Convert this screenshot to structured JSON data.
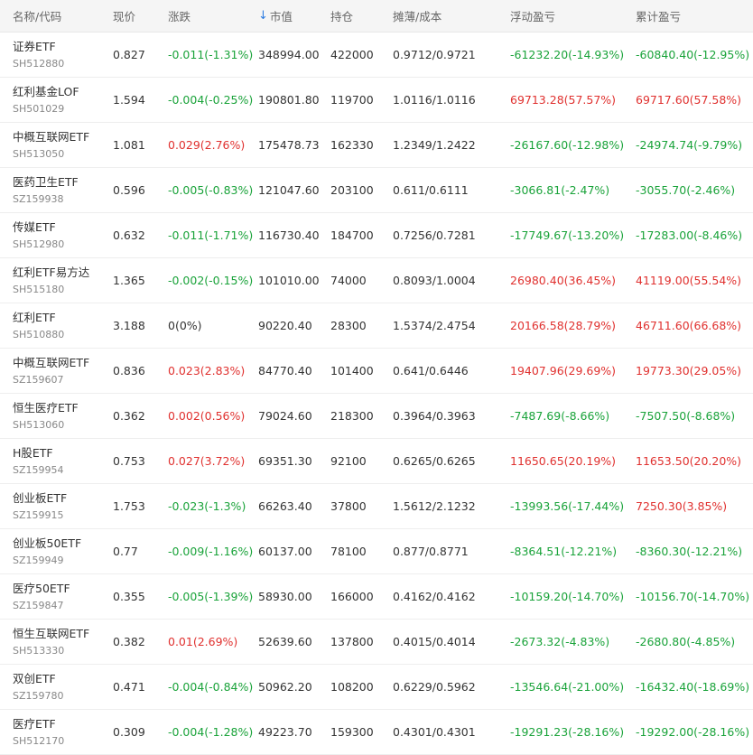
{
  "colors": {
    "up": "#e0312f",
    "down": "#1aa33a",
    "flat": "#333333",
    "sort_arrow": "#2f7de1"
  },
  "header": {
    "name_code": "名称/代码",
    "price": "现价",
    "change": "涨跌",
    "sort_icon": "arrow-down-icon",
    "market_value": "市值",
    "position": "持仓",
    "cost": "摊薄/成本",
    "floating_pl": "浮动盈亏",
    "cumulative_pl": "累计盈亏"
  },
  "rows": [
    {
      "name": "证券ETF",
      "code": "SH512880",
      "price": "0.827",
      "change": "-0.011(-1.31%)",
      "change_dir": "neg",
      "market_value": "348994.00",
      "position": "422000",
      "cost": "0.9712/0.9721",
      "floating_pl": "-61232.20(-14.93%)",
      "floating_dir": "neg",
      "cumulative_pl": "-60840.40(-12.95%)",
      "cumulative_dir": "neg"
    },
    {
      "name": "红利基金LOF",
      "code": "SH501029",
      "price": "1.594",
      "change": "-0.004(-0.25%)",
      "change_dir": "neg",
      "market_value": "190801.80",
      "position": "119700",
      "cost": "1.0116/1.0116",
      "floating_pl": "69713.28(57.57%)",
      "floating_dir": "pos",
      "cumulative_pl": "69717.60(57.58%)",
      "cumulative_dir": "pos"
    },
    {
      "name": "中概互联网ETF",
      "code": "SH513050",
      "price": "1.081",
      "change": "0.029(2.76%)",
      "change_dir": "pos",
      "market_value": "175478.73",
      "position": "162330",
      "cost": "1.2349/1.2422",
      "floating_pl": "-26167.60(-12.98%)",
      "floating_dir": "neg",
      "cumulative_pl": "-24974.74(-9.79%)",
      "cumulative_dir": "neg"
    },
    {
      "name": "医药卫生ETF",
      "code": "SZ159938",
      "price": "0.596",
      "change": "-0.005(-0.83%)",
      "change_dir": "neg",
      "market_value": "121047.60",
      "position": "203100",
      "cost": "0.611/0.6111",
      "floating_pl": "-3066.81(-2.47%)",
      "floating_dir": "neg",
      "cumulative_pl": "-3055.70(-2.46%)",
      "cumulative_dir": "neg"
    },
    {
      "name": "传媒ETF",
      "code": "SH512980",
      "price": "0.632",
      "change": "-0.011(-1.71%)",
      "change_dir": "neg",
      "market_value": "116730.40",
      "position": "184700",
      "cost": "0.7256/0.7281",
      "floating_pl": "-17749.67(-13.20%)",
      "floating_dir": "neg",
      "cumulative_pl": "-17283.00(-8.46%)",
      "cumulative_dir": "neg"
    },
    {
      "name": "红利ETF易方达",
      "code": "SH515180",
      "price": "1.365",
      "change": "-0.002(-0.15%)",
      "change_dir": "neg",
      "market_value": "101010.00",
      "position": "74000",
      "cost": "0.8093/1.0004",
      "floating_pl": "26980.40(36.45%)",
      "floating_dir": "pos",
      "cumulative_pl": "41119.00(55.54%)",
      "cumulative_dir": "pos"
    },
    {
      "name": "红利ETF",
      "code": "SH510880",
      "price": "3.188",
      "change": "0(0%)",
      "change_dir": "neu",
      "market_value": "90220.40",
      "position": "28300",
      "cost": "1.5374/2.4754",
      "floating_pl": "20166.58(28.79%)",
      "floating_dir": "pos",
      "cumulative_pl": "46711.60(66.68%)",
      "cumulative_dir": "pos"
    },
    {
      "name": "中概互联网ETF",
      "code": "SZ159607",
      "price": "0.836",
      "change": "0.023(2.83%)",
      "change_dir": "pos",
      "market_value": "84770.40",
      "position": "101400",
      "cost": "0.641/0.6446",
      "floating_pl": "19407.96(29.69%)",
      "floating_dir": "pos",
      "cumulative_pl": "19773.30(29.05%)",
      "cumulative_dir": "pos"
    },
    {
      "name": "恒生医疗ETF",
      "code": "SH513060",
      "price": "0.362",
      "change": "0.002(0.56%)",
      "change_dir": "pos",
      "market_value": "79024.60",
      "position": "218300",
      "cost": "0.3964/0.3963",
      "floating_pl": "-7487.69(-8.66%)",
      "floating_dir": "neg",
      "cumulative_pl": "-7507.50(-8.68%)",
      "cumulative_dir": "neg"
    },
    {
      "name": "H股ETF",
      "code": "SZ159954",
      "price": "0.753",
      "change": "0.027(3.72%)",
      "change_dir": "pos",
      "market_value": "69351.30",
      "position": "92100",
      "cost": "0.6265/0.6265",
      "floating_pl": "11650.65(20.19%)",
      "floating_dir": "pos",
      "cumulative_pl": "11653.50(20.20%)",
      "cumulative_dir": "pos"
    },
    {
      "name": "创业板ETF",
      "code": "SZ159915",
      "price": "1.753",
      "change": "-0.023(-1.3%)",
      "change_dir": "neg",
      "market_value": "66263.40",
      "position": "37800",
      "cost": "1.5612/2.1232",
      "floating_pl": "-13993.56(-17.44%)",
      "floating_dir": "neg",
      "cumulative_pl": "7250.30(3.85%)",
      "cumulative_dir": "pos"
    },
    {
      "name": "创业板50ETF",
      "code": "SZ159949",
      "price": "0.77",
      "change": "-0.009(-1.16%)",
      "change_dir": "neg",
      "market_value": "60137.00",
      "position": "78100",
      "cost": "0.877/0.8771",
      "floating_pl": "-8364.51(-12.21%)",
      "floating_dir": "neg",
      "cumulative_pl": "-8360.30(-12.21%)",
      "cumulative_dir": "neg"
    },
    {
      "name": "医疗50ETF",
      "code": "SZ159847",
      "price": "0.355",
      "change": "-0.005(-1.39%)",
      "change_dir": "neg",
      "market_value": "58930.00",
      "position": "166000",
      "cost": "0.4162/0.4162",
      "floating_pl": "-10159.20(-14.70%)",
      "floating_dir": "neg",
      "cumulative_pl": "-10156.70(-14.70%)",
      "cumulative_dir": "neg"
    },
    {
      "name": "恒生互联网ETF",
      "code": "SH513330",
      "price": "0.382",
      "change": "0.01(2.69%)",
      "change_dir": "pos",
      "market_value": "52639.60",
      "position": "137800",
      "cost": "0.4015/0.4014",
      "floating_pl": "-2673.32(-4.83%)",
      "floating_dir": "neg",
      "cumulative_pl": "-2680.80(-4.85%)",
      "cumulative_dir": "neg"
    },
    {
      "name": "双创ETF",
      "code": "SZ159780",
      "price": "0.471",
      "change": "-0.004(-0.84%)",
      "change_dir": "neg",
      "market_value": "50962.20",
      "position": "108200",
      "cost": "0.6229/0.5962",
      "floating_pl": "-13546.64(-21.00%)",
      "floating_dir": "neg",
      "cumulative_pl": "-16432.40(-18.69%)",
      "cumulative_dir": "neg"
    },
    {
      "name": "医疗ETF",
      "code": "SH512170",
      "price": "0.309",
      "change": "-0.004(-1.28%)",
      "change_dir": "neg",
      "market_value": "49223.70",
      "position": "159300",
      "cost": "0.4301/0.4301",
      "floating_pl": "-19291.23(-28.16%)",
      "floating_dir": "neg",
      "cumulative_pl": "-19292.00(-28.16%)",
      "cumulative_dir": "neg"
    }
  ]
}
